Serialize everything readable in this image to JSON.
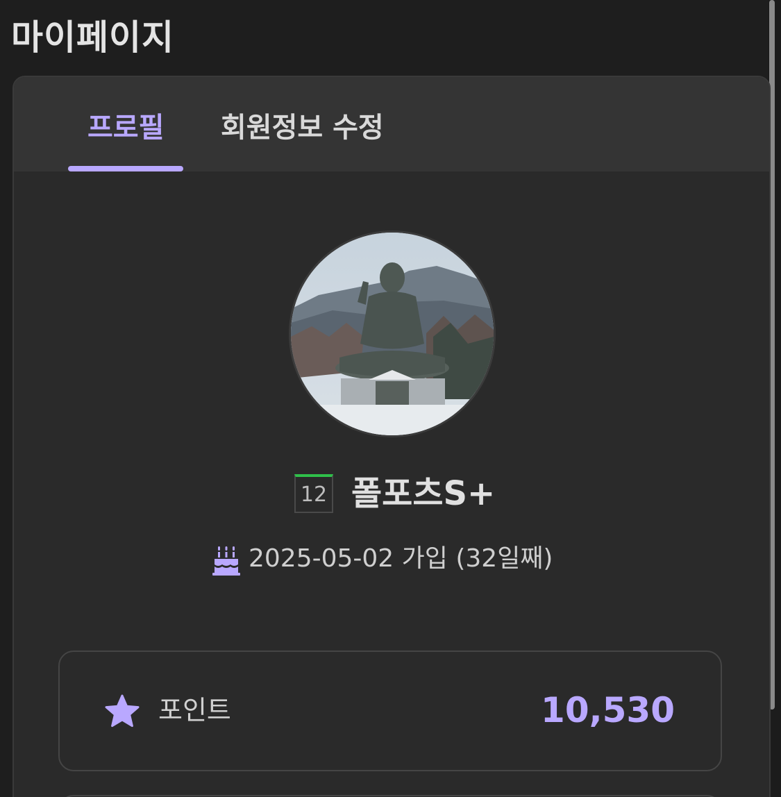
{
  "header": {
    "title": "마이페이지"
  },
  "tabs": [
    {
      "label": "프로필",
      "active": true
    },
    {
      "label": "회원정보 수정",
      "active": false
    }
  ],
  "profile": {
    "level": "12",
    "nickname": "폴포츠S+",
    "join_text": "2025-05-02 가입 (32일째)"
  },
  "points": {
    "label": "포인트",
    "value": "10,530"
  },
  "icons": {
    "join": "cake-icon",
    "points": "star-icon"
  },
  "colors": {
    "accent": "#b9a8ff",
    "background": "#1e1e1e",
    "card": "#2a2a2a",
    "tabbar": "#343434",
    "level_bar": "#2fc04a"
  }
}
